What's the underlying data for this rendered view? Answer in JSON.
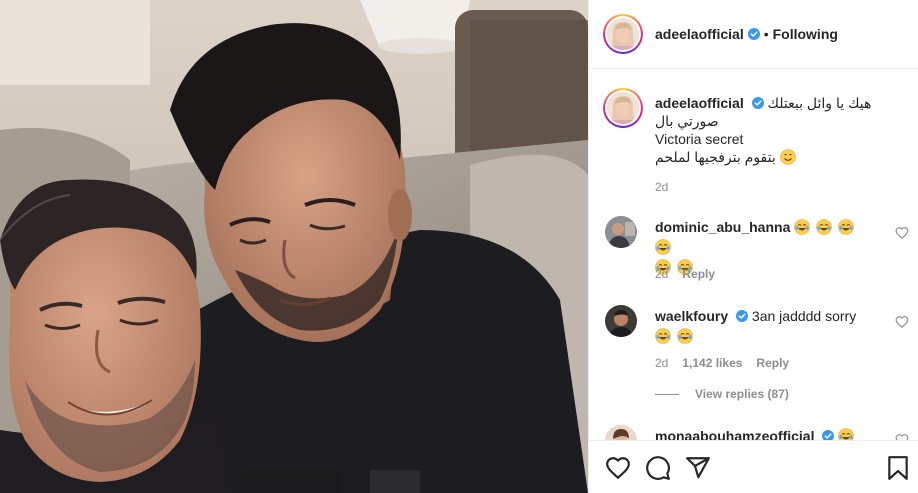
{
  "post": {
    "username": "adeelaofficial",
    "separator": "•",
    "follow_status": "Following"
  },
  "caption": {
    "username": "adeelaofficial",
    "line1": "هيك يا وائل ببعتلك",
    "line2": "صورتي بال",
    "line3": "Victoria secret",
    "line4": "بتقوم بترفجيها لملحم",
    "line4_emoji": "smiling-face",
    "time": "2d"
  },
  "comments": [
    {
      "username": "dominic_abu_hanna",
      "verified": false,
      "text": "",
      "emoji": [
        "tears-of-joy",
        "tears-of-joy",
        "tears-of-joy",
        "tears-of-joy",
        "tears-of-joy",
        "tears-of-joy"
      ],
      "time": "2d",
      "likes": "",
      "reply_label": "Reply"
    },
    {
      "username": "waelkfoury",
      "verified": true,
      "text": "3an jadddd sorry",
      "emoji": [
        "tears-of-joy",
        "tears-of-joy"
      ],
      "time": "2d",
      "likes": "1,142 likes",
      "reply_label": "Reply"
    },
    {
      "username": "monaabouhamzeofficial",
      "verified": true,
      "text": "",
      "emoji": [
        "tears-of-joy"
      ],
      "time": "",
      "likes": "",
      "reply_label": ""
    }
  ],
  "view_replies": "View replies (87)",
  "icons": {
    "like": "heart-icon",
    "comment": "comment-icon",
    "share": "paper-plane-icon",
    "save": "bookmark-icon",
    "verified": "verified-badge-icon"
  },
  "colors": {
    "verified": "#3897f0",
    "text": "#262626",
    "secondary": "#8e8e8e",
    "border": "#efefef"
  }
}
